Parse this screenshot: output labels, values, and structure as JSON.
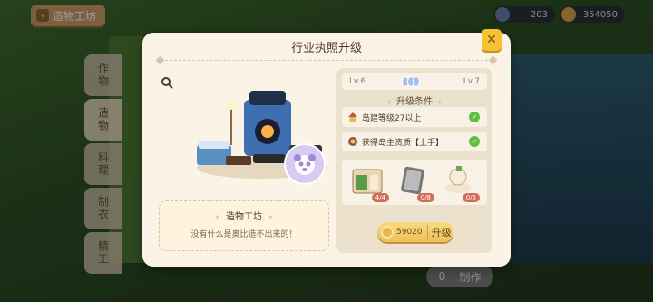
{
  "topbar": {
    "back_label": "造物工坊",
    "resource_1": "203",
    "resource_2": "354050"
  },
  "side_tabs": [
    "作物",
    "造物",
    "料理",
    "制衣",
    "精工"
  ],
  "background": {
    "make_count": "0",
    "make_label": "制作"
  },
  "dialog": {
    "title": "行业执照升级",
    "close_icon": "close-icon",
    "building_name": "造物工坊",
    "building_desc": "没有什么是奥比造不出来的！",
    "level_from": "Lv.6",
    "level_to": "Lv.7",
    "conditions_title": "升级条件",
    "conditions": [
      {
        "icon": "house-icon",
        "text": "岛建等级27以上",
        "met": true
      },
      {
        "icon": "medal-icon",
        "text": "获得岛主资质【上手】",
        "met": true
      }
    ],
    "materials": [
      {
        "icon": "cabinet-icon",
        "qty": "4/4"
      },
      {
        "icon": "metal-plate-icon",
        "qty": "0/8"
      },
      {
        "icon": "fabric-bundle-icon",
        "qty": "0/3"
      }
    ],
    "upgrade_cost": "59020",
    "upgrade_label": "升级"
  },
  "colors": {
    "dialog_bg": "#fbf4e6",
    "accent_yellow": "#f4c233",
    "check_green": "#5fbf3e",
    "qty_red": "#d26b55"
  }
}
